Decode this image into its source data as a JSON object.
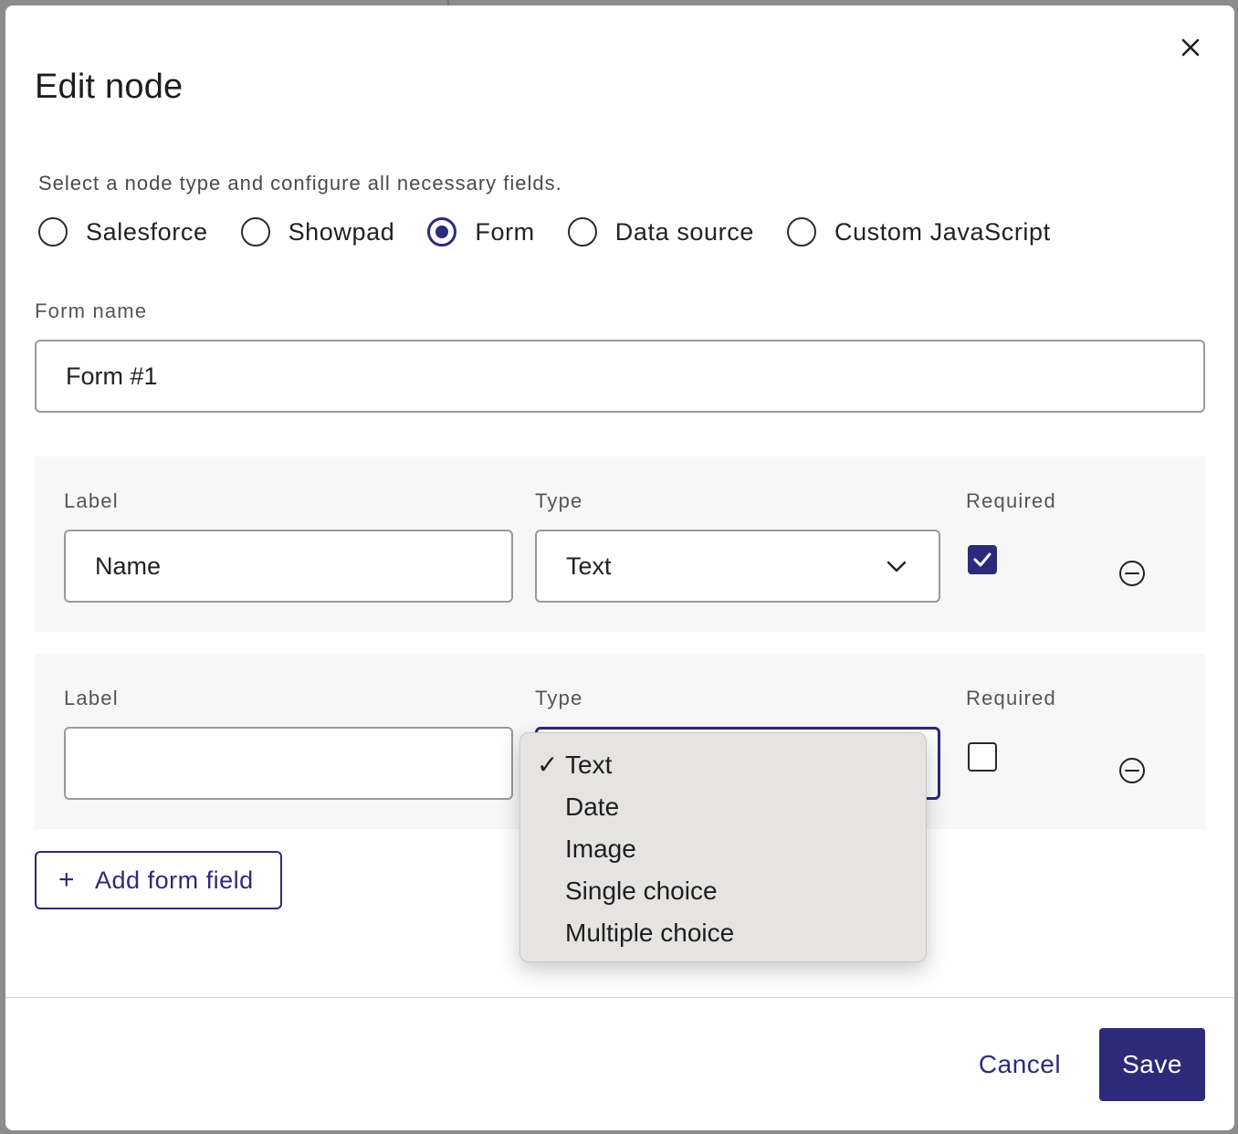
{
  "dialog": {
    "title": "Edit node",
    "subtitle": "Select a node type and configure all necessary fields."
  },
  "node_types": [
    {
      "label": "Salesforce",
      "selected": false
    },
    {
      "label": "Showpad",
      "selected": false
    },
    {
      "label": "Form",
      "selected": true
    },
    {
      "label": "Data source",
      "selected": false
    },
    {
      "label": "Custom JavaScript",
      "selected": false
    }
  ],
  "form_name": {
    "label": "Form name",
    "value": "Form #1"
  },
  "fields": [
    {
      "label_header": "Label",
      "type_header": "Type",
      "required_header": "Required",
      "label_value": "Name",
      "type_value": "Text",
      "required": true
    },
    {
      "label_header": "Label",
      "type_header": "Type",
      "required_header": "Required",
      "label_value": "",
      "type_value": "Text",
      "required": false
    }
  ],
  "type_dropdown": {
    "options": [
      "Text",
      "Date",
      "Image",
      "Single choice",
      "Multiple choice"
    ],
    "selected": "Text",
    "check_glyph": "✓"
  },
  "add_field_button": {
    "icon": "plus-icon",
    "glyph": "+",
    "label": "Add form field"
  },
  "footer": {
    "cancel_label": "Cancel",
    "save_label": "Save"
  },
  "colors": {
    "accent": "#2d2a7a",
    "panel": "#f7f7f7",
    "dropdown": "#e5e4e2"
  }
}
